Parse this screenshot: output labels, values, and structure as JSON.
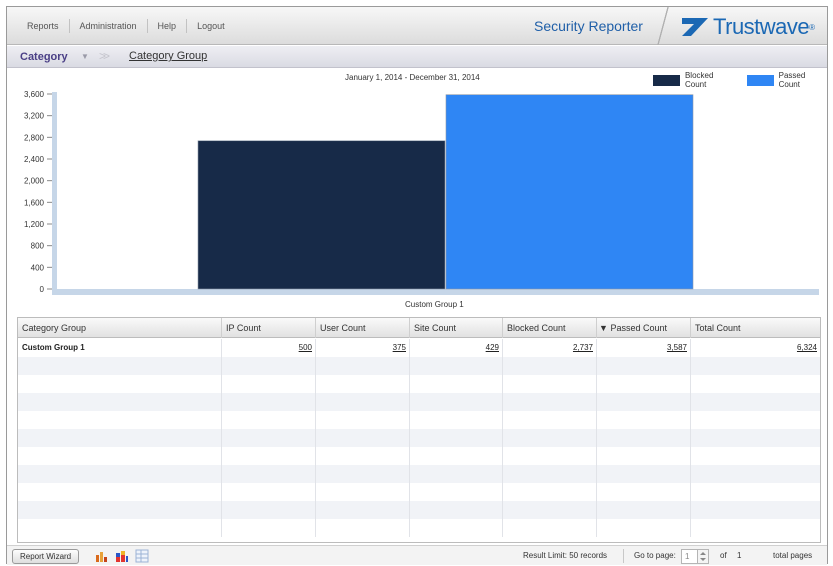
{
  "nav": {
    "items": [
      {
        "label": "Reports"
      },
      {
        "label": "Administration"
      },
      {
        "label": "Help"
      },
      {
        "label": "Logout"
      }
    ],
    "product_name": "Security Reporter",
    "logo_text": "Trustwave",
    "logo_mark": "®"
  },
  "breadcrumb": {
    "category": "Category",
    "caret_icon": "chevron-down-icon",
    "separator": ">>",
    "current": "Category Group"
  },
  "chart_data": {
    "type": "bar",
    "title": "January 1, 2014 - December 31, 2014",
    "categories": [
      "Custom Group 1"
    ],
    "series": [
      {
        "name": "Blocked Count",
        "values": [
          2737
        ],
        "color": "#172a48"
      },
      {
        "name": "Passed Count",
        "values": [
          3587
        ],
        "color": "#2f86f4"
      }
    ],
    "yticks": [
      "0",
      "400",
      "800",
      "1,200",
      "1,600",
      "2,000",
      "2,400",
      "2,800",
      "3,200",
      "3,600"
    ],
    "ylim": [
      0,
      3600
    ],
    "legend_position": "top-right",
    "grid": false
  },
  "table": {
    "columns": [
      {
        "label": "Category Group"
      },
      {
        "label": "IP Count"
      },
      {
        "label": "User Count"
      },
      {
        "label": "Site Count"
      },
      {
        "label": "Blocked Count"
      },
      {
        "label": "Passed Count",
        "sort_icon": "sort-desc-icon",
        "sort_glyph": "▼"
      },
      {
        "label": "Total Count"
      }
    ],
    "rows": [
      {
        "cells": [
          "Custom Group 1",
          "500",
          "375",
          "429",
          "2,737",
          "3,587",
          "6,324"
        ]
      }
    ]
  },
  "footer": {
    "wizard_label": "Report Wizard",
    "icons": [
      "bar-chart-icon",
      "stacked-chart-icon",
      "table-view-icon"
    ],
    "result_limit": "Result Limit: 50 records",
    "goto_label": "Go to page:",
    "page_value": "1",
    "of_label": "of",
    "total_pages_value": "1",
    "total_pages_label": "total pages"
  },
  "colors": {
    "accent": "#1b68b4",
    "breadcrumb": "#4a3f86",
    "blocked": "#172a48",
    "passed": "#2f86f4"
  }
}
